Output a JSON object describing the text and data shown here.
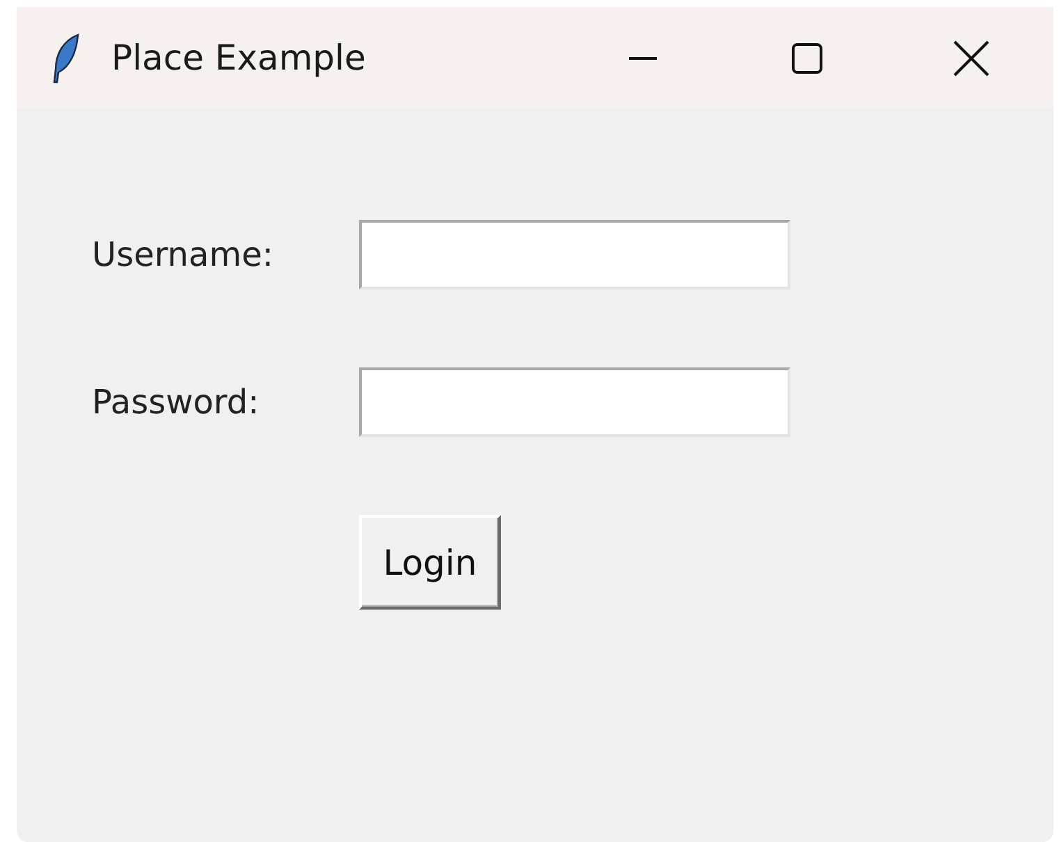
{
  "window": {
    "title": "Place Example"
  },
  "fields": [
    {
      "label": "Username:"
    },
    {
      "label": "Password:"
    }
  ],
  "button": "Login"
}
